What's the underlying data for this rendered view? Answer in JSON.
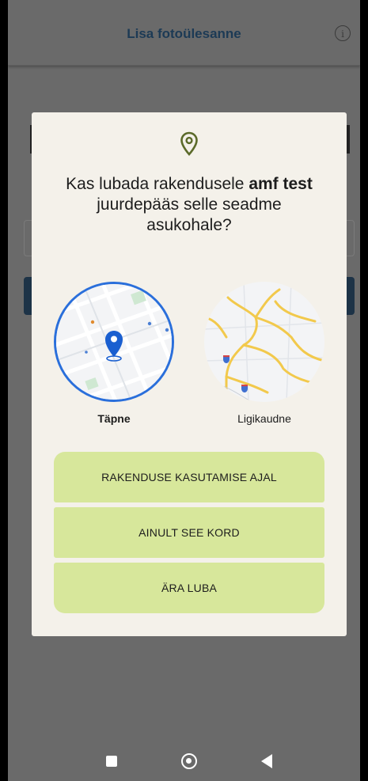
{
  "app": {
    "title": "Lisa fotoülesanne",
    "info_icon": "info-icon",
    "info_glyph": "i"
  },
  "dialog": {
    "icon": "location-pin-icon",
    "question_prefix": "Kas lubada rakendusele ",
    "app_name": "amf test",
    "question_suffix": " juurdepääs selle seadme asukohale?",
    "options": {
      "precise": {
        "label": "Täpne",
        "selected": true
      },
      "approximate": {
        "label": "Ligikaudne",
        "selected": false
      }
    },
    "buttons": {
      "while_using": "RAKENDUSE KASUTAMISE AJAL",
      "only_this_time": "AINULT SEE KORD",
      "deny": "ÄRA LUBA"
    }
  },
  "navbar": {
    "recents": "recents-icon",
    "home": "home-icon",
    "back": "back-icon"
  },
  "colors": {
    "scrim": "#6a6a6a",
    "dialog_bg": "#f4f1ea",
    "button_bg": "#d7e79b",
    "accent_blue": "#2a6fdb",
    "pin_green": "#5b6a2a"
  }
}
